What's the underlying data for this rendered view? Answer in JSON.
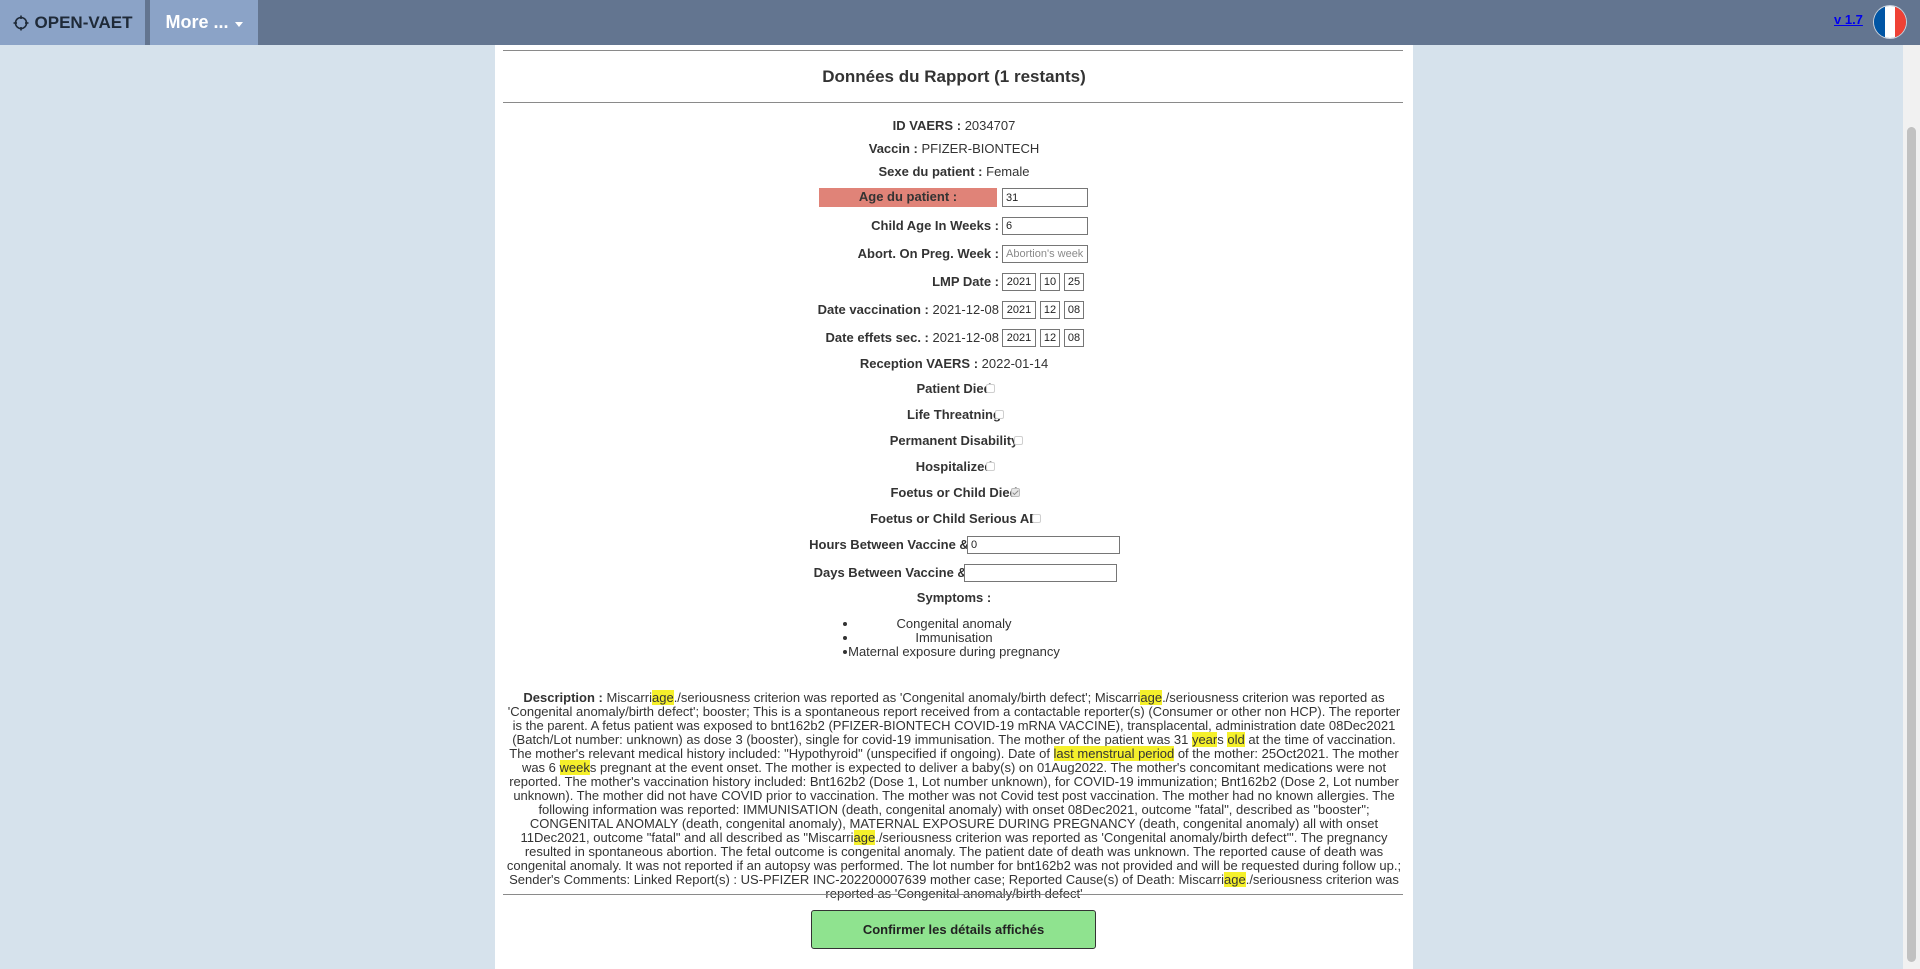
{
  "navbar": {
    "brand": "OPEN-VAET",
    "more_label": "More ...",
    "version": "v 1.7",
    "flag_colors": [
      "#0055a4",
      "#ffffff",
      "#ef4135"
    ]
  },
  "report": {
    "title": "Données du Rapport (1 restants)",
    "vaers_id": {
      "label": "ID VAERS :",
      "value": "2034707"
    },
    "vaccine": {
      "label": "Vaccin :",
      "value": "PFIZER-BIONTECH"
    },
    "sex": {
      "label": "Sexe du patient :",
      "value": "Female"
    },
    "age": {
      "label": "Age du patient :",
      "value": "31"
    },
    "child_age_weeks": {
      "label": "Child Age In Weeks :",
      "value": "6"
    },
    "abortion_week": {
      "label": "Abort. On Preg. Week :",
      "placeholder": "Abortion's week"
    },
    "lmp_date": {
      "label": "LMP Date :",
      "year": "2021",
      "month": "10",
      "day": "25"
    },
    "vaccination_date": {
      "label": "Date vaccination :",
      "text": "2021-12-08",
      "year": "2021",
      "month": "12",
      "day": "08"
    },
    "side_effects_date": {
      "label": "Date effets sec. :",
      "text": "2021-12-08",
      "year": "2021",
      "month": "12",
      "day": "08"
    },
    "reception": {
      "label": "Reception VAERS :",
      "value": "2022-01-14"
    },
    "checkboxes": [
      {
        "label": "Patient Died",
        "checked": false
      },
      {
        "label": "Life Threatning",
        "checked": false
      },
      {
        "label": "Permanent Disability",
        "checked": false
      },
      {
        "label": "Hospitalized",
        "checked": false
      },
      {
        "label": "Foetus or Child Died",
        "checked": true
      },
      {
        "label": "Foetus or Child Serious AE",
        "checked": false
      }
    ],
    "hours_between": {
      "label": "Hours Between Vaccine & AE",
      "value": "0"
    },
    "days_between": {
      "label": "Days Between Vaccine & AE",
      "value": ""
    },
    "symptoms_label": "Symptoms :",
    "symptoms": [
      "Congenital anomaly",
      "Immunisation",
      "Maternal exposure during pregnancy"
    ],
    "description_label": "Description :",
    "description_html": "Miscarri<span class=\"hl\">age</span>./seriousness criterion was reported as 'Congenital anomaly/birth defect'; Miscarri<span class=\"hl\">age</span>./seriousness criterion was reported as 'Congenital anomaly/birth defect'; booster; This is a spontaneous report received from a contactable reporter(s) (Consumer or other non HCP). The reporter is the parent. A fetus patient was exposed to bnt162b2 (PFIZER-BIONTECH COVID-19 mRNA VACCINE), transplacental, administration date 08Dec2021 (Batch/Lot number: unknown) as dose 3 (booster), single for covid-19 immunisation. The mother of the patient was 31 <span class=\"hl\">year</span>s <span class=\"hl\">old</span> at the time of vaccination. The mother's relevant medical history included: \"Hypothyroid\" (unspecified if ongoing). Date of <span class=\"hl\">last menstrual period</span> of the mother: 25Oct2021. The mother was 6 <span class=\"hl\">week</span>s pregnant at the event onset. The mother is expected to deliver a baby(s) on 01Aug2022. The mother's concomitant medications were not reported. The mother's vaccination history included: Bnt162b2 (Dose 1, Lot number unknown), for COVID-19 immunization; Bnt162b2 (Dose 2, Lot number unknown). The mother did not have COVID prior to vaccination. The mother was not Covid test post vaccination. The mother had no known allergies. The following information was reported: IMMUNISATION (death, congenital anomaly) with onset 08Dec2021, outcome \"fatal\", described as \"booster\"; CONGENITAL ANOMALY (death, congenital anomaly), MATERNAL EXPOSURE DURING PREGNANCY (death, congenital anomaly) all with onset 11Dec2021, outcome \"fatal\" and all described as \"Miscarri<span class=\"hl\">age</span>./seriousness criterion was reported as 'Congenital anomaly/birth defect'\". The pregnancy resulted in spontaneous abortion. The fetal outcome is congenital anomaly. The patient date of death was unknown. The reported cause of death was congenital anomaly. It was not reported if an autopsy was performed. The lot number for bnt162b2 was not provided and will be requested during follow up.; Sender's Comments: Linked Report(s) : US-PFIZER INC-202200007639 mother case; Reported Cause(s) of Death: Miscarri<span class=\"hl\">age</span>./seriousness criterion was reported as 'Congenital anomaly/birth defect'",
    "confirm_label": "Confirmer les détails affichés"
  }
}
